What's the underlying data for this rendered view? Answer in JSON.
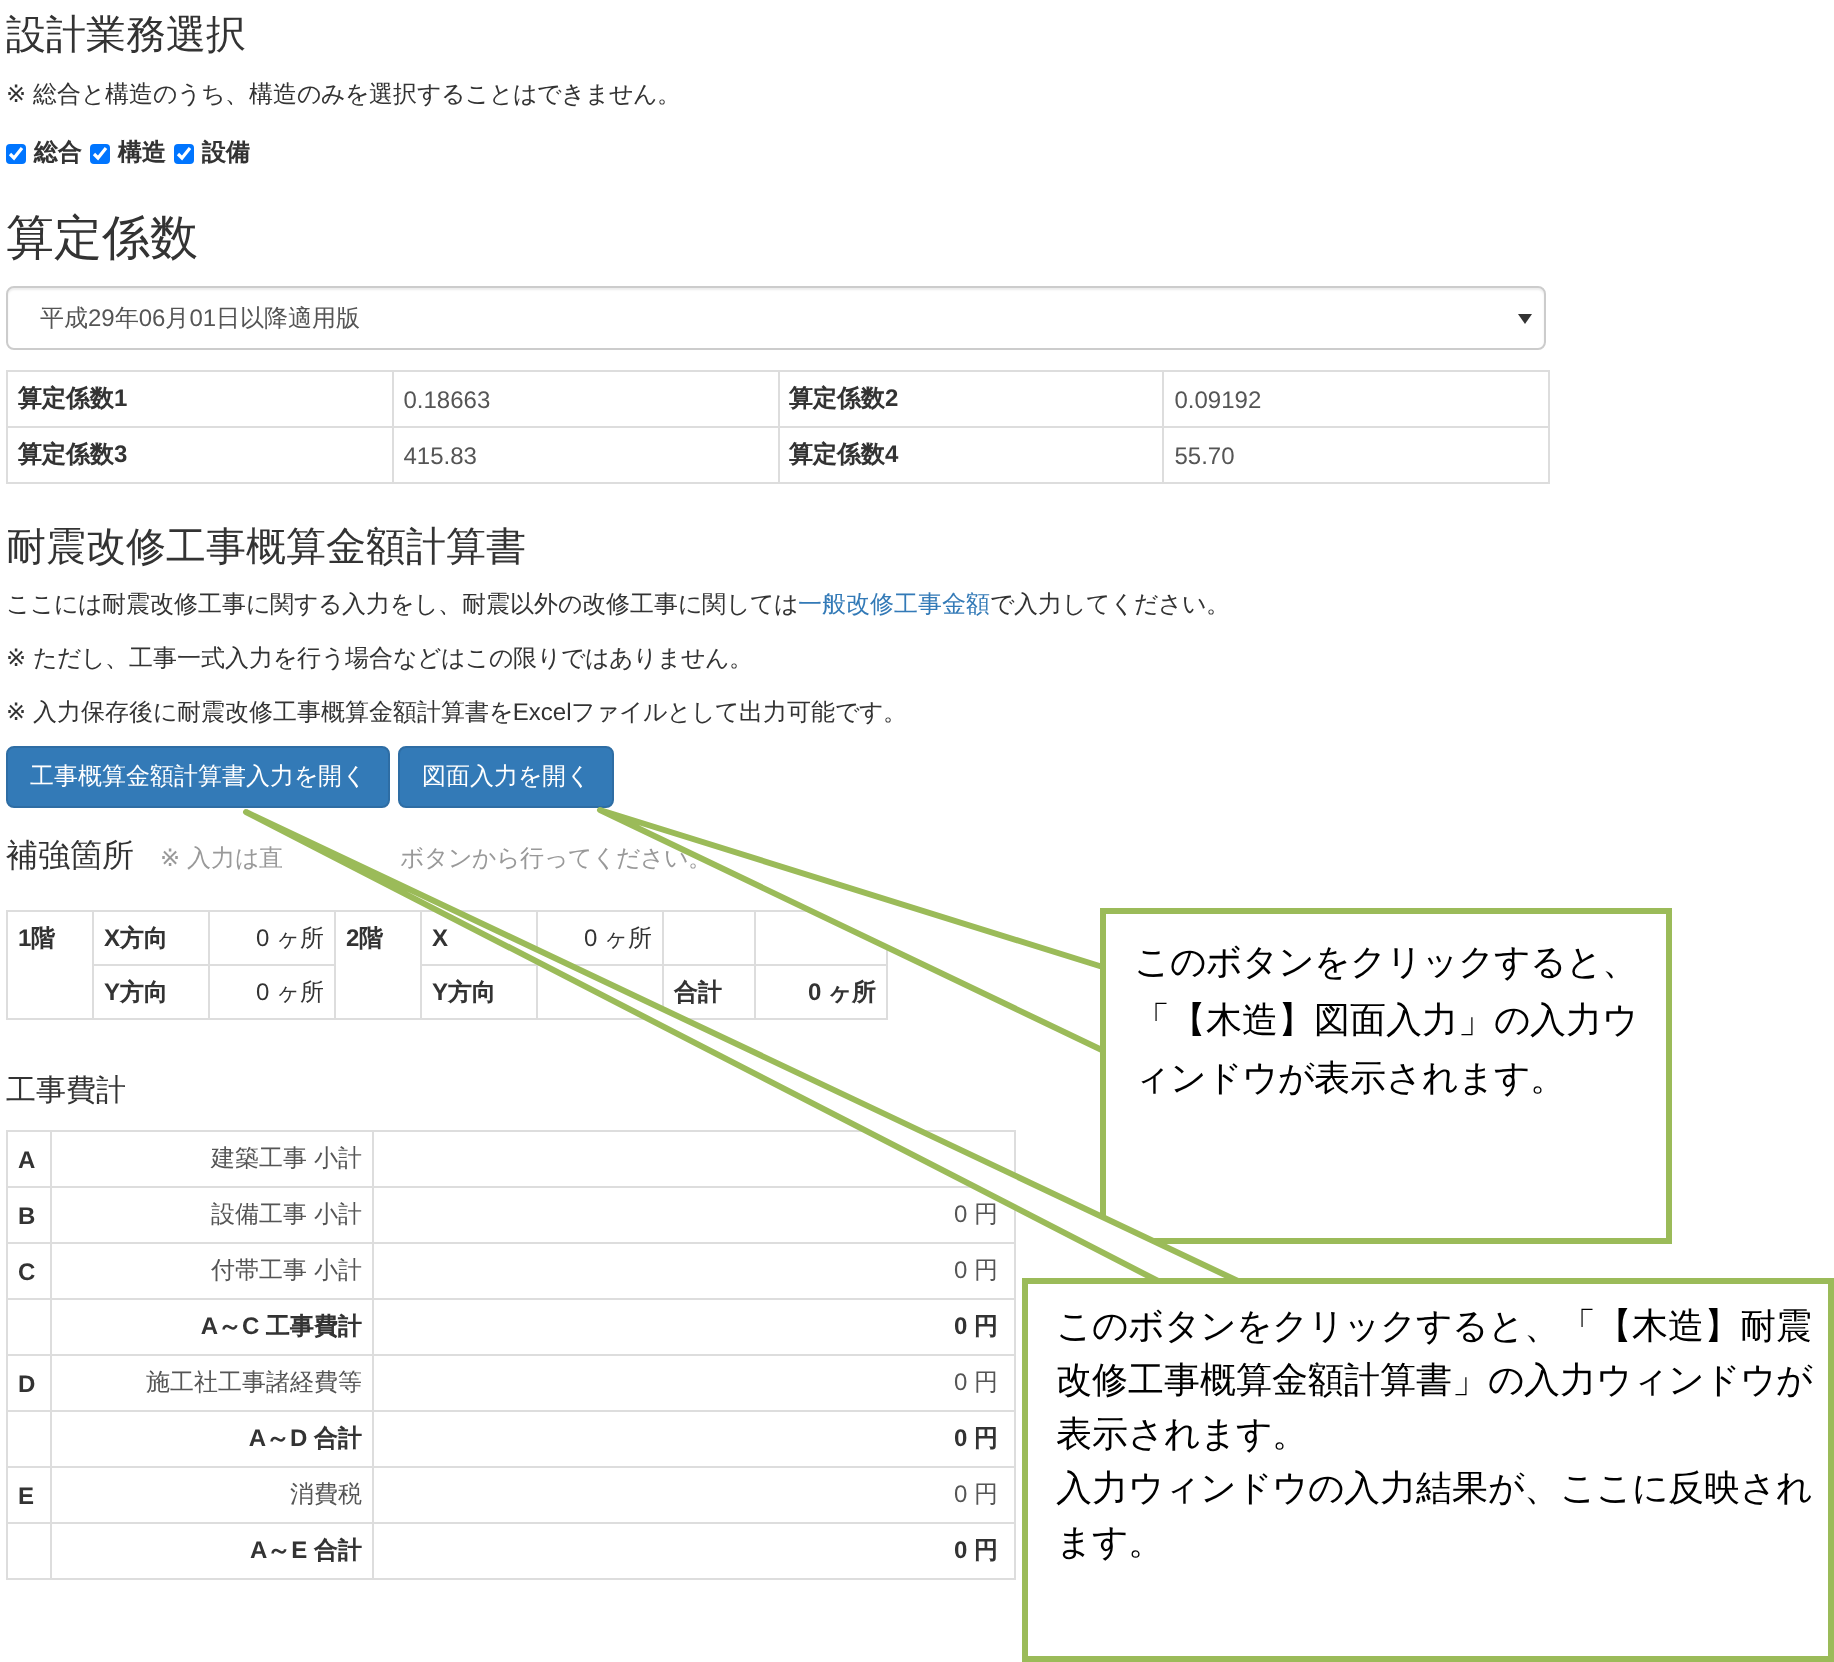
{
  "design_selection": {
    "title": "設計業務選択",
    "note": "※ 総合と構造のうち、構造のみを選択することはできません。",
    "options": [
      {
        "label": "総合",
        "checked": true
      },
      {
        "label": "構造",
        "checked": true
      },
      {
        "label": "設備",
        "checked": true
      }
    ]
  },
  "coefficients": {
    "title": "算定係数",
    "select": {
      "value": "平成29年06月01日以降適用版"
    },
    "rows": [
      [
        {
          "label": "算定係数1",
          "value": "0.18663"
        },
        {
          "label": "算定係数2",
          "value": "0.09192"
        }
      ],
      [
        {
          "label": "算定係数3",
          "value": "415.83"
        },
        {
          "label": "算定係数4",
          "value": "55.70"
        }
      ]
    ]
  },
  "estimate": {
    "title": "耐震改修工事概算金額計算書",
    "intro": {
      "before": "ここには耐震改修工事に関する入力をし、耐震以外の改修工事に関しては",
      "link": "一般改修工事金額",
      "after": "で入力してください。"
    },
    "notes": [
      "※ ただし、工事一式入力を行う場合などはこの限りではありません。",
      "※ 入力保存後に耐震改修工事概算金額計算書をExcelファイルとして出力可能です。"
    ],
    "buttons": [
      "工事概算金額計算書入力を開く",
      "図面入力を開く"
    ]
  },
  "reinforcement": {
    "title": "補強箇所",
    "note_parts": [
      "※ 入力は直",
      "ボタンから行ってください。"
    ],
    "floors": [
      {
        "floor": "1階",
        "rows": [
          {
            "direction": "X方向",
            "count": "0 ヶ所"
          },
          {
            "direction": "Y方向",
            "count": "0 ヶ所"
          }
        ]
      },
      {
        "floor": "2階",
        "rows": [
          {
            "direction": "X",
            "count": "0 ヶ所"
          },
          {
            "direction": "Y方向"
          }
        ]
      }
    ],
    "total": {
      "label": "合計",
      "count": "0 ヶ所"
    }
  },
  "costs": {
    "title": "工事費計",
    "rows": [
      {
        "code": "A",
        "label": "建築工事 小計",
        "kind": "item"
      },
      {
        "code": "B",
        "label": "設備工事 小計",
        "amount": "0 円",
        "kind": "item"
      },
      {
        "code": "C",
        "label": "付帯工事 小計",
        "amount": "0 円",
        "kind": "item"
      },
      {
        "label": "A～C 工事費計",
        "amount": "0 円",
        "kind": "total"
      },
      {
        "code": "D",
        "label": "施工社工事諸経費等",
        "amount": "0 円",
        "kind": "item"
      },
      {
        "label": "A～D 合計",
        "amount": "0 円",
        "kind": "total"
      },
      {
        "code": "E",
        "label": "消費税",
        "amount": "0 円",
        "kind": "item"
      },
      {
        "label": "A～E 合計",
        "amount": "0 円",
        "kind": "total"
      }
    ]
  },
  "callouts": [
    {
      "paragraphs": [
        "このボタンをクリックすると、「【木造】図面入力」の入力ウィンドウが表示されます。"
      ]
    },
    {
      "paragraphs": [
        "このボタンをクリックすると、「【木造】耐震改修工事概算金額計算書」の入力ウィンドウが表示されます。",
        "入力ウィンドウの入力結果が、ここに反映されます。"
      ]
    }
  ]
}
